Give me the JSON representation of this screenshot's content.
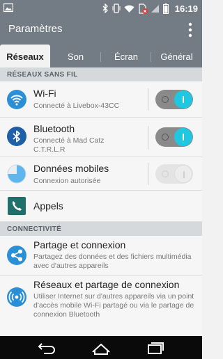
{
  "status_bar": {
    "time": "16:19",
    "icons": [
      "image-icon",
      "bluetooth-icon",
      "vibrate-icon",
      "wifi-icon",
      "sim-error-icon",
      "signal-icon",
      "battery-icon"
    ]
  },
  "app_bar": {
    "title": "Paramètres",
    "menu_icon": "overflow-menu-icon"
  },
  "tabs": [
    {
      "label": "Réseaux",
      "active": true
    },
    {
      "label": "Son",
      "active": false
    },
    {
      "label": "Écran",
      "active": false
    },
    {
      "label": "Général",
      "active": false
    }
  ],
  "sections": {
    "wireless": "RÉSEAUX SANS FIL",
    "connectivity": "CONNECTIVITÉ"
  },
  "rows": {
    "wifi": {
      "title": "Wi-Fi",
      "subtitle": "Connecté à Livebox-43CC",
      "on": true
    },
    "bluetooth": {
      "title": "Bluetooth",
      "subtitle": "Connecté à Mad Catz C.T.R.L.R",
      "on": true
    },
    "mobile_data": {
      "title": "Données mobiles",
      "subtitle": "Connexion autorisée",
      "on": false
    },
    "calls": {
      "title": "Appels"
    },
    "share": {
      "title": "Partage et connexion",
      "subtitle": "Partagez des données et des fichiers multimédia avec d'autres appareils"
    },
    "tethering": {
      "title": "Réseaux et partage de connexion",
      "subtitle": "Utiliser Internet sur d'autres appareils via un point d'accès mobile Wi-Fi partagé ou via le partage de connexion Bluetooth"
    }
  },
  "colors": {
    "bar": "#737b84",
    "accent": "#1fc8e0",
    "icon_blue": "#2b8fd6"
  }
}
